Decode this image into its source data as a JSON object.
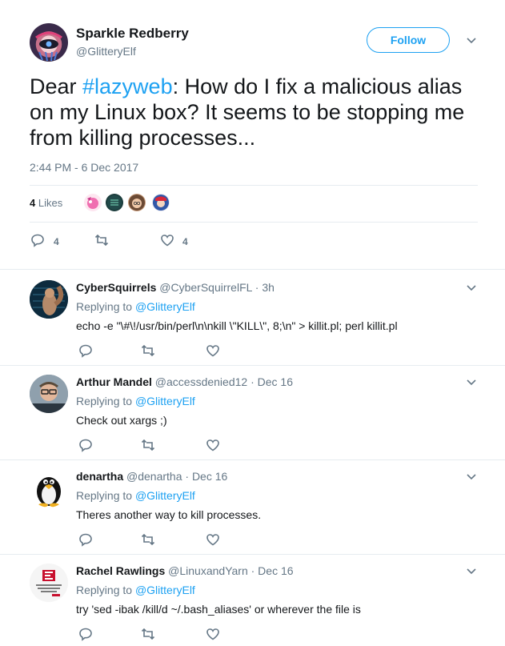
{
  "tweet": {
    "author_name": "Sparkle Redberry",
    "author_handle": "@GlitteryElf",
    "follow_label": "Follow",
    "text_prefix": "Dear ",
    "hashtag": "#lazyweb",
    "text_suffix": ": How do I fix a malicious alias on my Linux box? It seems to be stopping me from killing processes...",
    "timestamp": "2:44 PM - 6 Dec 2017",
    "likes_count": "4",
    "likes_label": "Likes",
    "reply_count": "4",
    "like_count": "4"
  },
  "replies": [
    {
      "name": "CyberSquirrels",
      "meta": "@CyberSquirrelFL · 3h",
      "replying_label": "Replying to",
      "replying_to": "@GlitteryElf",
      "text": "echo -e \"\\#\\!/usr/bin/perl\\n\\nkill \\\"KILL\\\", 8;\\n\" > killit.pl; perl killit.pl"
    },
    {
      "name": "Arthur Mandel",
      "meta": "@accessdenied12 · Dec 16",
      "replying_label": "Replying to",
      "replying_to": "@GlitteryElf",
      "text": "Check out xargs ;)"
    },
    {
      "name": "denartha",
      "meta": "@denartha · Dec 16",
      "replying_label": "Replying to",
      "replying_to": "@GlitteryElf",
      "text": "Theres another way to kill processes."
    },
    {
      "name": "Rachel Rawlings",
      "meta": "@LinuxandYarn · Dec 16",
      "replying_label": "Replying to",
      "replying_to": "@GlitteryElf",
      "text": "try 'sed -ibak /kill/d ~/.bash_aliases' or wherever the file is"
    }
  ],
  "colors": {
    "accent": "#1da1f2",
    "muted": "#657786",
    "divider": "#e6ecf0"
  }
}
